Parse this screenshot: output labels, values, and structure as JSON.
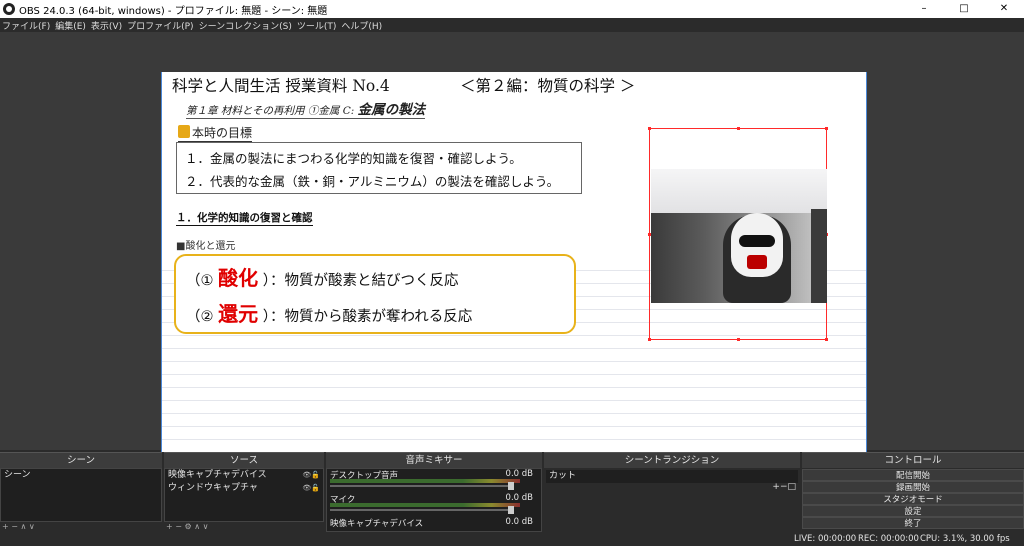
{
  "window": {
    "title": "OBS 24.0.3 (64-bit, windows) - プロファイル: 無題 - シーン: 無題",
    "minimize": "–",
    "maximize": "□",
    "close": "✕"
  },
  "menu": [
    "ファイル(F)",
    "編集(E)",
    "表示(V)",
    "プロファイル(P)",
    "シーンコレクション(S)",
    "ツール(T)",
    "ヘルプ(H)"
  ],
  "slide": {
    "title": "科学と人間生活 授業資料 No.4",
    "part": "＜第２編：物質の科学 ＞",
    "subtitle_small": "第１章 材料とその再利用 ①金属 C:",
    "subtitle_big": "金属の製法",
    "goal_heading": "本時の目標",
    "goals": [
      "１．金属の製法にまつわる化学的知識を復習・確認しよう。",
      "２．代表的な金属（鉄・銅・アルミニウム）の製法を確認しよう。"
    ],
    "section": "１．化学的知識の復習と確認",
    "subsection": "■酸化と還元",
    "definitions": [
      {
        "prefix": "（①",
        "key": "酸化",
        "suffix": "）：物質が酸素と結びつく反応"
      },
      {
        "prefix": "（②",
        "key": "還元",
        "suffix": "）：物質から酸素が奪われる反応"
      }
    ]
  },
  "docks": {
    "scenes": {
      "title": "シーン",
      "items": [
        "シーン"
      ],
      "tools": "+ −  ∧ ∨"
    },
    "sources": {
      "title": "ソース",
      "items": [
        "映像キャプチャデバイス",
        "ウィンドウキャプチャ"
      ],
      "tools": "+ − ⚙ ∧ ∨"
    },
    "mixer": {
      "title": "音声ミキサー",
      "channels": [
        {
          "name": "デスクトップ音声",
          "db": "0.0 dB"
        },
        {
          "name": "マイク",
          "db": "0.0 dB"
        },
        {
          "name": "映像キャプチャデバイス",
          "db": "0.0 dB"
        }
      ]
    },
    "transitions": {
      "title": "シーントランジション",
      "selected": "カット",
      "tools": "+−□"
    },
    "controls": {
      "title": "コントロール",
      "buttons": [
        "配信開始",
        "録画開始",
        "スタジオモード",
        "設定",
        "終了"
      ]
    }
  },
  "status": {
    "live": "LIVE: 00:00:00",
    "rec": "REC: 00:00:00",
    "cpu": "CPU: 3.1%, 30.00 fps"
  },
  "colors": {
    "accent_red": "#e00000",
    "box_yellow": "#e8b21a",
    "source_bbox": "#ff2a2a",
    "canvas_border": "#4a88d8"
  }
}
